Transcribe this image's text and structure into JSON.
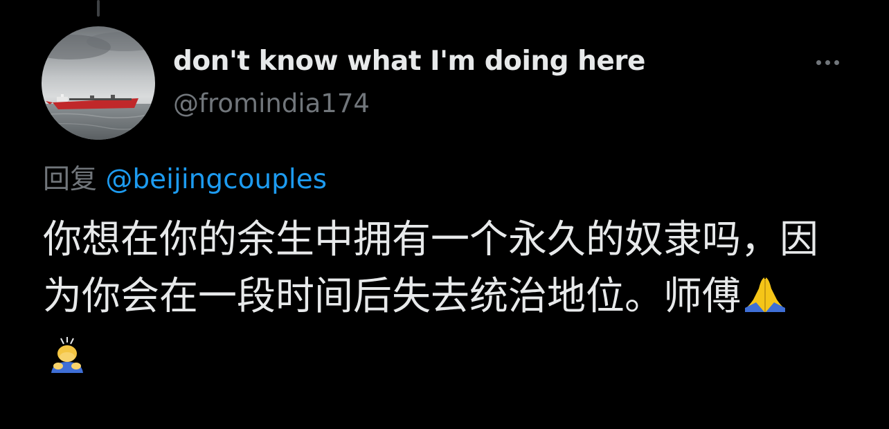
{
  "tweet": {
    "author": {
      "display_name": "don't know what I'm doing here",
      "handle": "@fromindia174",
      "avatar_icon": "ship-photo-avatar"
    },
    "more_icon": "more-options-icon",
    "reply": {
      "label": "回复",
      "mention": "@beijingcouples"
    },
    "text": "你想在你的余生中拥有一个永久的奴隶吗，因为你会在一段时间后失去统治地位。师傅",
    "emojis": [
      "folded-hands-emoji",
      "person-bowing-emoji"
    ]
  },
  "colors": {
    "background": "#000000",
    "primary_text": "#e7e9ea",
    "secondary_text": "#71767b",
    "link": "#1d9bf0"
  }
}
